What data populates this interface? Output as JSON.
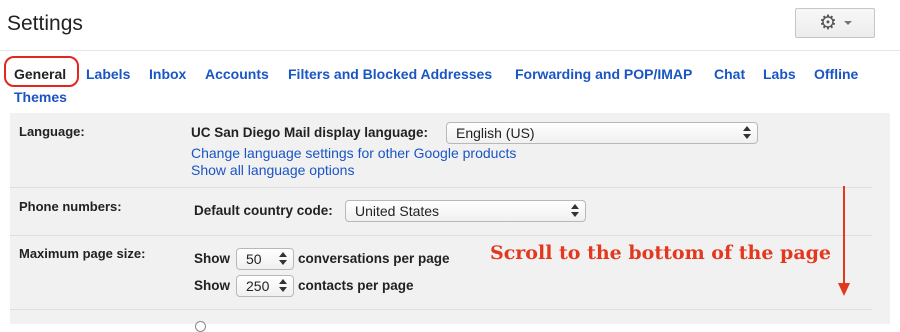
{
  "header": {
    "title": "Settings",
    "settings_icon": "gear-icon",
    "dropdown_icon": "chevron-down-icon"
  },
  "tabs": [
    {
      "label": "General",
      "active": true
    },
    {
      "label": "Labels"
    },
    {
      "label": "Inbox"
    },
    {
      "label": "Accounts"
    },
    {
      "label": "Filters and Blocked Addresses"
    },
    {
      "label": "Forwarding and POP/IMAP"
    },
    {
      "label": "Chat"
    },
    {
      "label": "Labs"
    },
    {
      "label": "Offline"
    },
    {
      "label": "Themes"
    }
  ],
  "settings": {
    "language": {
      "label": "Language:",
      "display_language_label": "UC San Diego Mail display language:",
      "display_language_value": "English (US)",
      "link_change": "Change language settings for other Google products",
      "link_show_all": "Show all language options"
    },
    "phone": {
      "label": "Phone numbers:",
      "country_code_label": "Default country code:",
      "country_code_value": "United States"
    },
    "page_size": {
      "label": "Maximum page size:",
      "show_label": "Show",
      "conversations_value": "50",
      "conversations_suffix": "conversations per page",
      "contacts_value": "250",
      "contacts_suffix": "contacts per page"
    }
  },
  "annotation": {
    "text": "Scroll to the bottom of the page",
    "color": "#e2381e"
  },
  "colors": {
    "link": "#1a55c4",
    "highlight_circle": "#e0281e",
    "panel_background": "#f1f1f1"
  }
}
